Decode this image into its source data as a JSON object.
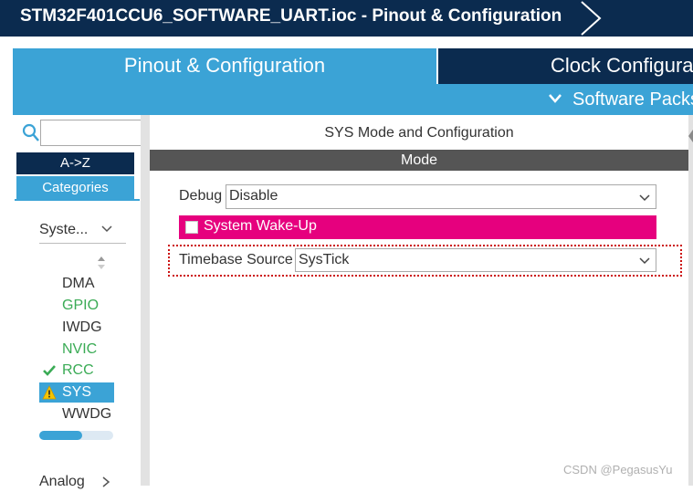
{
  "window": {
    "title": "STM32F401CCU6_SOFTWARE_UART.ioc - Pinout & Configuration"
  },
  "tabs": [
    {
      "label": "Pinout & Configuration",
      "active": true
    },
    {
      "label": "Clock Configuration",
      "active": false
    }
  ],
  "software_packs": {
    "label": "Software Packs"
  },
  "sidebar": {
    "search": {
      "value": "",
      "placeholder": ""
    },
    "sort_az_label": "A->Z",
    "categories_label": "Categories",
    "group": {
      "label": "System Core"
    },
    "items": [
      {
        "label": "DMA",
        "status": "none"
      },
      {
        "label": "GPIO",
        "status": "configured-green"
      },
      {
        "label": "IWDG",
        "status": "none"
      },
      {
        "label": "NVIC",
        "status": "configured-green"
      },
      {
        "label": "RCC",
        "status": "check"
      },
      {
        "label": "SYS",
        "status": "warning",
        "selected": true
      },
      {
        "label": "WWDG",
        "status": "none"
      }
    ],
    "next_group": {
      "label": "Analog"
    },
    "scroll_fraction": 0.58
  },
  "main": {
    "header": "SYS Mode and Configuration",
    "section_label": "Mode",
    "debug": {
      "label": "Debug",
      "value": "Disable"
    },
    "system_wakeup": {
      "label": "System Wake-Up",
      "checked": false
    },
    "timebase": {
      "label": "Timebase Source",
      "value": "SysTick"
    }
  },
  "watermark": "CSDN @PegasusYu",
  "colors": {
    "title_bar": "#0b2b4f",
    "accent_blue": "#3ba3d6",
    "mode_bar": "#555555",
    "wakeup_pink": "#e6007e",
    "green_text": "#3aab55",
    "highlight_red": "#cc1111"
  }
}
